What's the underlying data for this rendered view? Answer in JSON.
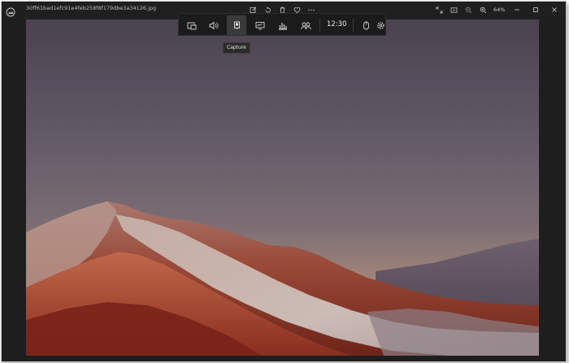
{
  "titlebar": {
    "filename": "30ff61bad1efc91e4feb258f8f179dbe3a34126.jpg",
    "zoom_level": "64%",
    "icons": [
      "app-logo-icon",
      "edit-image-icon",
      "rotate-icon",
      "delete-icon",
      "favorite-icon",
      "more-icon",
      "full-screen-icon",
      "slideshow-icon",
      "zoom-out-icon",
      "zoom-in-icon"
    ]
  },
  "window_controls": [
    "minimize-icon",
    "maximize-icon",
    "close-icon"
  ],
  "gamebar": {
    "widgets": [
      "widget-menu-icon",
      "audio-icon",
      "capture-icon",
      "performance-icon",
      "resources-icon",
      "xbox-social-icon"
    ],
    "active_widget": "capture",
    "time": "12:30",
    "right_icons": [
      "mouse-icon",
      "settings-icon"
    ]
  },
  "tooltip": {
    "label": "Capture"
  },
  "colors": {
    "sky_top": "#4a4250",
    "sky_mid": "#6a6270",
    "sky_horizon": "#b48f78",
    "mountain_red": "#8a2e20",
    "mountain_snow": "#d8d2cc"
  }
}
